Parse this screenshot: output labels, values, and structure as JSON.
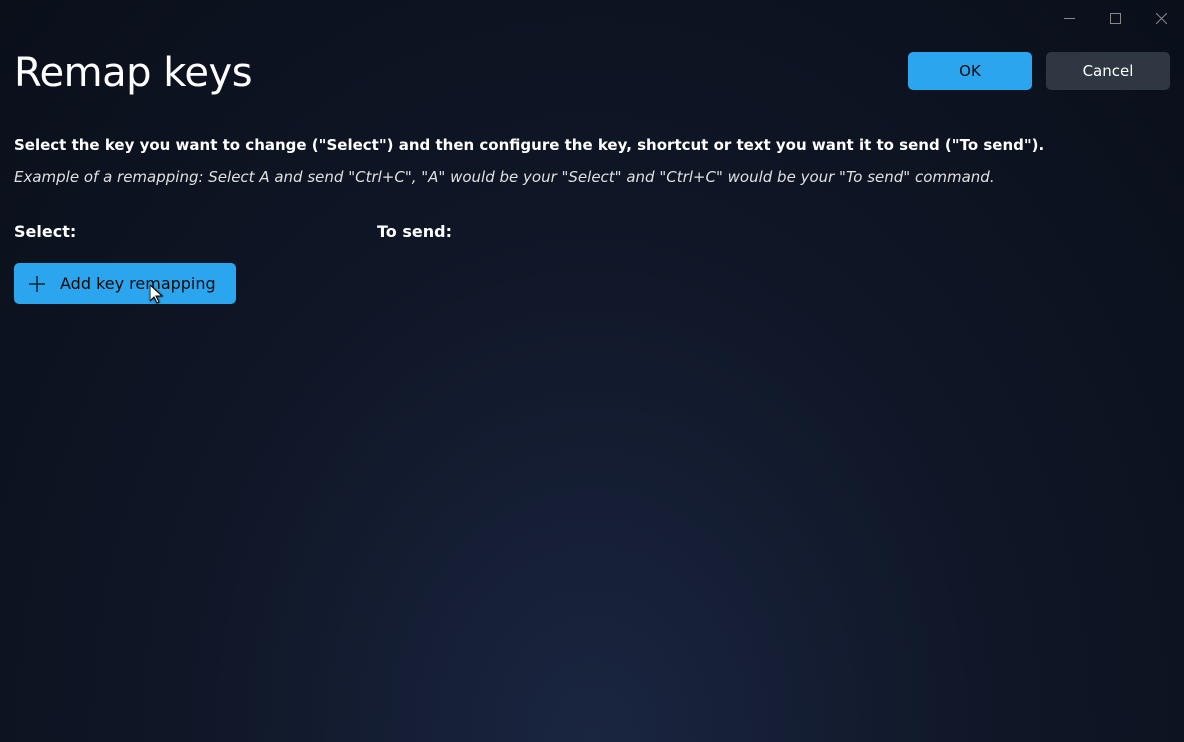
{
  "titlebar": {
    "minimize_icon": "minimize-icon",
    "maximize_icon": "maximize-icon",
    "close_icon": "close-icon"
  },
  "header": {
    "title": "Remap keys",
    "ok_label": "OK",
    "cancel_label": "Cancel"
  },
  "instruction_text": "Select the key you want to change (\"Select\") and then configure the key, shortcut or text you want it to send (\"To send\").",
  "example_text": "Example of a remapping: Select A and send \"Ctrl+C\", \"A\" would be your \"Select\" and \"Ctrl+C\" would be your \"To send\" command.",
  "columns": {
    "select_label": "Select:",
    "to_send_label": "To send:"
  },
  "add_button": {
    "label": "Add key remapping"
  },
  "colors": {
    "accent": "#2aa5ee",
    "secondary_button": "#2e3742"
  }
}
